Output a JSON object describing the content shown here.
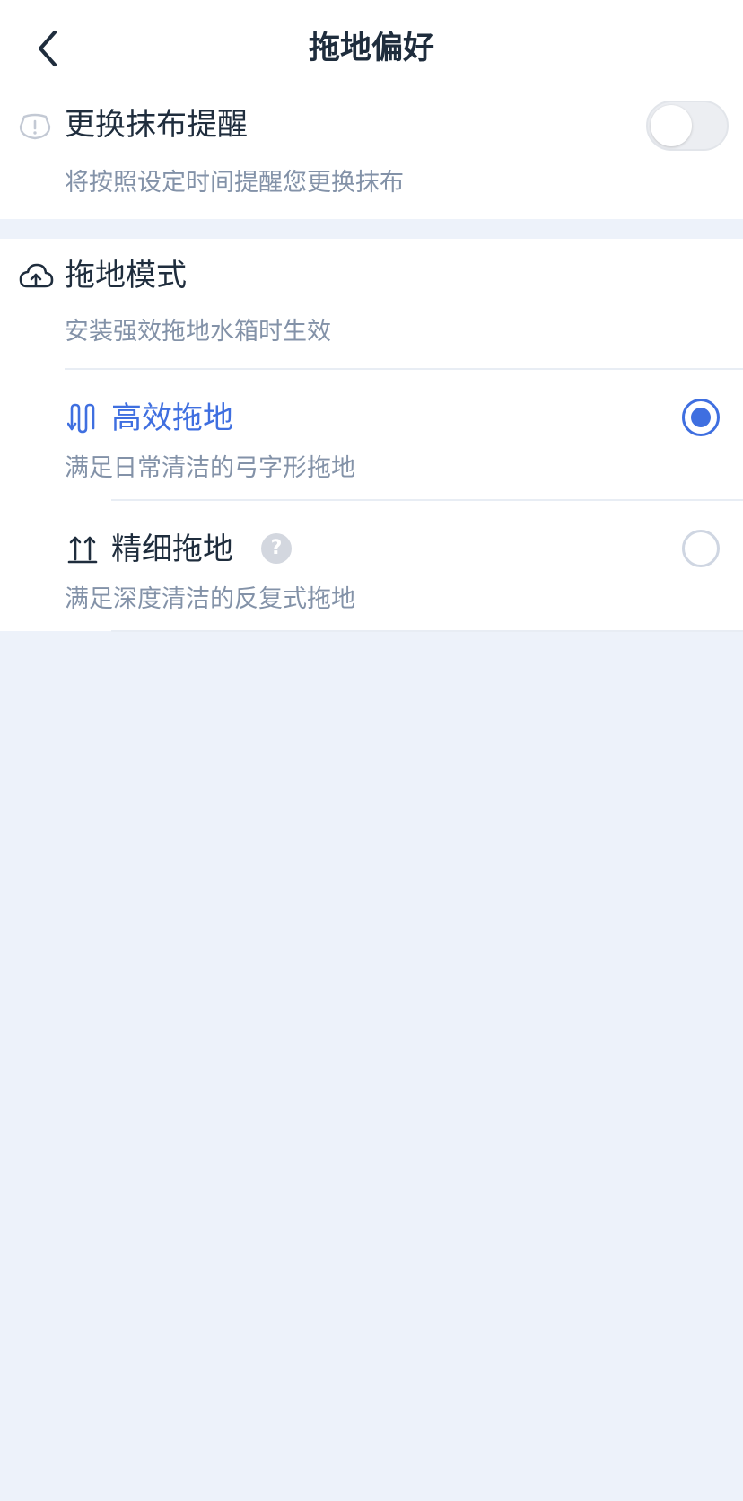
{
  "header": {
    "title": "拖地偏好",
    "back_icon": "chevron-left-icon"
  },
  "mop_reminder": {
    "icon": "cloth-alert-icon",
    "title": "更换抹布提醒",
    "subtitle": "将按照设定时间提醒您更换抹布",
    "toggle_on": false
  },
  "mop_mode": {
    "icon": "cloud-upload-icon",
    "title": "拖地模式",
    "subtitle": "安装强效拖地水箱时生效",
    "options": [
      {
        "icon": "zigzag-path-icon",
        "label": "高效拖地",
        "description": "满足日常清洁的弓字形拖地",
        "selected": true
      },
      {
        "icon": "back-forth-path-icon",
        "label": "精细拖地",
        "description": "满足深度清洁的反复式拖地",
        "selected": false,
        "help_icon": "question-icon",
        "help_glyph": "?"
      }
    ]
  },
  "colors": {
    "accent": "#3f6fe0",
    "text_primary": "#1f2d3d",
    "text_secondary": "#8392a8",
    "background": "#edf2fa"
  }
}
